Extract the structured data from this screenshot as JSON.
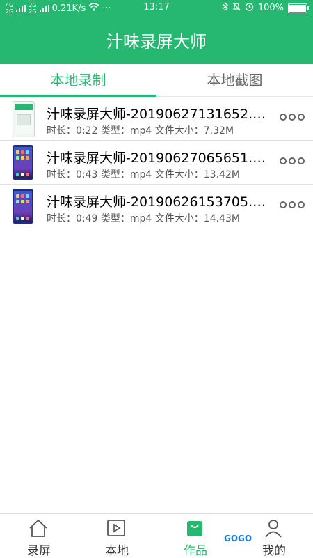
{
  "status_bar": {
    "net_left_top": "4G",
    "net_left_bottom": "2G",
    "net_right_top": "2G",
    "net_right_bottom": "2G",
    "speed": "0.21K/s",
    "time": "13:17",
    "battery": "100%",
    "battery_level": 1.0
  },
  "header": {
    "title": "汁味录屏大师"
  },
  "tabs": [
    {
      "label": "本地录制",
      "active": true
    },
    {
      "label": "本地截图",
      "active": false
    }
  ],
  "files": [
    {
      "name": "汁味录屏大师-20190627131652.…",
      "meta": "时长：0:22 类型：mp4 文件大小：7.32M",
      "thumb": "green-app"
    },
    {
      "name": "汁味录屏大师-20190627065651.…",
      "meta": "时长：0:43 类型：mp4 文件大小：13.42M",
      "thumb": "phone-home"
    },
    {
      "name": "汁味录屏大师-20190626153705.…",
      "meta": "时长：0:49 类型：mp4 文件大小：14.43M",
      "thumb": "phone-home"
    }
  ],
  "bottom_nav": [
    {
      "label": "录屏",
      "icon": "home-icon"
    },
    {
      "label": "本地",
      "icon": "play-icon"
    },
    {
      "label": "作品",
      "icon": "bag-icon",
      "active": true
    },
    {
      "label": "我的",
      "icon": "user-icon"
    }
  ],
  "watermark": "GOGO",
  "colors": {
    "accent": "#26b871"
  }
}
